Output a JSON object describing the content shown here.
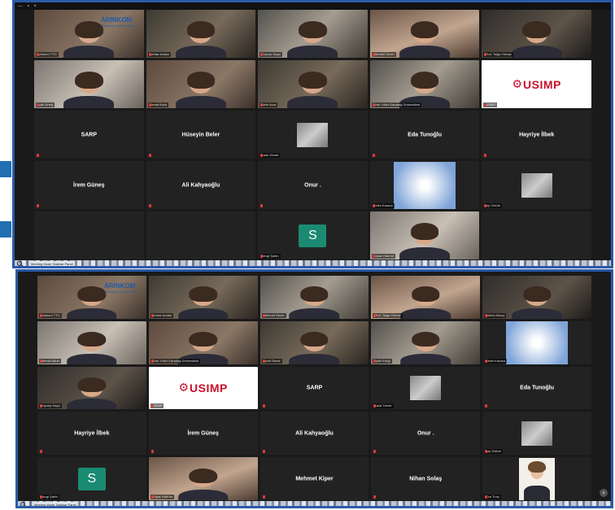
{
  "window1": {
    "taskbar_label": "Meeting Mode Taskbar Panel",
    "rows": [
      [
        {
          "kind": "video",
          "name": "Arinkom TTO",
          "brand": "ARINKOM",
          "brand_sub": "Teknoloji Transfer Ofisi"
        },
        {
          "kind": "video",
          "name": "Serdar Arslan"
        },
        {
          "kind": "video",
          "name": "Zeynep Kaya"
        },
        {
          "kind": "video",
          "name": "Mehmet Sezer"
        },
        {
          "kind": "video",
          "name": "Prof. Tolga Yılmaz"
        }
      ],
      [
        {
          "kind": "video",
          "name": "Aylin Ertuğ"
        },
        {
          "kind": "video",
          "name": "Kemal Bulut"
        },
        {
          "kind": "video",
          "name": "Selin Acar"
        },
        {
          "kind": "video",
          "name": "Ebru Yıldız Karadağ Üniversitesi"
        },
        {
          "kind": "logo",
          "name": "USIMP",
          "logo_text": "USIMP"
        }
      ],
      [
        {
          "kind": "name",
          "name": "SARP"
        },
        {
          "kind": "name",
          "name": "Hüseyin Beler"
        },
        {
          "kind": "mini",
          "name": "Kadir Demir"
        },
        {
          "kind": "name",
          "name": "Eda Tunoğlu"
        },
        {
          "kind": "name",
          "name": "Hayriye İlbek"
        }
      ],
      [
        {
          "kind": "name",
          "name": "İrem Güneş"
        },
        {
          "kind": "name",
          "name": "Ali Kahyaoğlu"
        },
        {
          "kind": "name",
          "name": "Onur ."
        },
        {
          "kind": "diagram",
          "name": "Selim Karaca"
        },
        {
          "kind": "mini",
          "name": "Alp Öztürk"
        }
      ],
      [
        {
          "kind": "empty"
        },
        {
          "kind": "empty"
        },
        {
          "kind": "avatar",
          "name": "Sevgi Şahin",
          "letter": "S"
        },
        {
          "kind": "video",
          "name": "Büşra Yıldırım"
        },
        {
          "kind": "empty"
        }
      ]
    ]
  },
  "window2": {
    "taskbar_label": "Meeting Mode Taskbar Panel",
    "rows": [
      [
        {
          "kind": "video",
          "name": "Arinkom TTO",
          "brand": "ARINKOM",
          "brand_sub": "Teknoloji Transfer Ofisi"
        },
        {
          "kind": "video",
          "name": "Serdar Arslan"
        },
        {
          "kind": "video",
          "name": "Mehmet Sezer"
        },
        {
          "kind": "video",
          "name": "Prof. Tolga Yılmaz"
        },
        {
          "kind": "video",
          "name": "Bülent Aksoy"
        }
      ],
      [
        {
          "kind": "video",
          "name": "Nermin Altun"
        },
        {
          "kind": "video",
          "name": "Ebru Yıldız Karadağ Üniversitesi"
        },
        {
          "kind": "video",
          "name": "Kadir Demir"
        },
        {
          "kind": "video",
          "name": "Aylin Ertuğ"
        },
        {
          "kind": "diagram",
          "name": "Selim Karaca"
        }
      ],
      [
        {
          "kind": "video",
          "name": "Zeynep Kaya"
        },
        {
          "kind": "logo",
          "name": "USIMP",
          "logo_text": "USIMP"
        },
        {
          "kind": "name",
          "name": "SARP"
        },
        {
          "kind": "mini",
          "name": "Kadir Demir"
        },
        {
          "kind": "name",
          "name": "Eda Tunoğlu"
        }
      ],
      [
        {
          "kind": "name",
          "name": "Hayriye İlbek"
        },
        {
          "kind": "name",
          "name": "İrem Güneş"
        },
        {
          "kind": "name",
          "name": "Ali Kahyaoğlu"
        },
        {
          "kind": "name",
          "name": "Onur ."
        },
        {
          "kind": "mini",
          "name": "Alp Öztürk"
        }
      ],
      [
        {
          "kind": "avatar",
          "name": "Sevgi Şahin",
          "letter": "S"
        },
        {
          "kind": "video",
          "name": "Büşra Yıldırım"
        },
        {
          "kind": "name",
          "name": "Mehmet Kiper"
        },
        {
          "kind": "name",
          "name": "Nihan Solaş"
        },
        {
          "kind": "whitephoto",
          "name": "Ece Tunç"
        }
      ]
    ]
  },
  "colors": {
    "accent": "#2b5aa8",
    "avatar": "#1b8a72",
    "usimp": "#c8102e"
  }
}
